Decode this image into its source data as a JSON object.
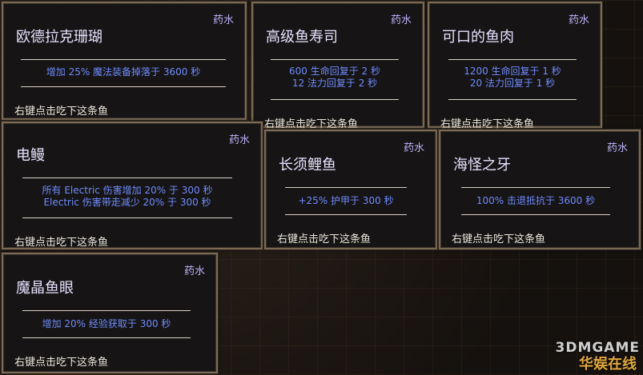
{
  "cards": [
    {
      "title": "欧德拉克珊瑚",
      "type": "药水",
      "effects": [
        "增加 25% 魔法装备掉落于 3600 秒"
      ],
      "hint": "右键点击吃下这条鱼"
    },
    {
      "title": "高级鱼寿司",
      "type": "药水",
      "effects": [
        "600 生命回复于 2 秒",
        "12 法力回复于 2 秒"
      ],
      "hint": "右键点击吃下这条鱼"
    },
    {
      "title": "可口的鱼肉",
      "type": "药水",
      "effects": [
        "1200 生命回复于 1 秒",
        "20 法力回复于 1 秒"
      ],
      "hint": "右键点击吃下这条鱼"
    },
    {
      "title": "电鳗",
      "type": "药水",
      "effects": [
        "所有 Electric 伤害增加 20% 于 300 秒",
        "Electric 伤害带走减少 20% 于 300 秒"
      ],
      "hint": "右键点击吃下这条鱼"
    },
    {
      "title": "长须鲤鱼",
      "type": "药水",
      "effects": [
        "+25% 护甲于 300 秒"
      ],
      "hint": "右键点击吃下这条鱼"
    },
    {
      "title": "海怪之牙",
      "type": "药水",
      "effects": [
        "100% 击退抵抗于 3600 秒"
      ],
      "hint": "右键点击吃下这条鱼"
    },
    {
      "title": "魔晶鱼眼",
      "type": "药水",
      "effects": [
        "增加 20% 经验获取于 300 秒"
      ],
      "hint": "右键点击吃下这条鱼"
    }
  ],
  "watermark": {
    "line1": "3DMGAME",
    "line2": "华娱在线"
  }
}
